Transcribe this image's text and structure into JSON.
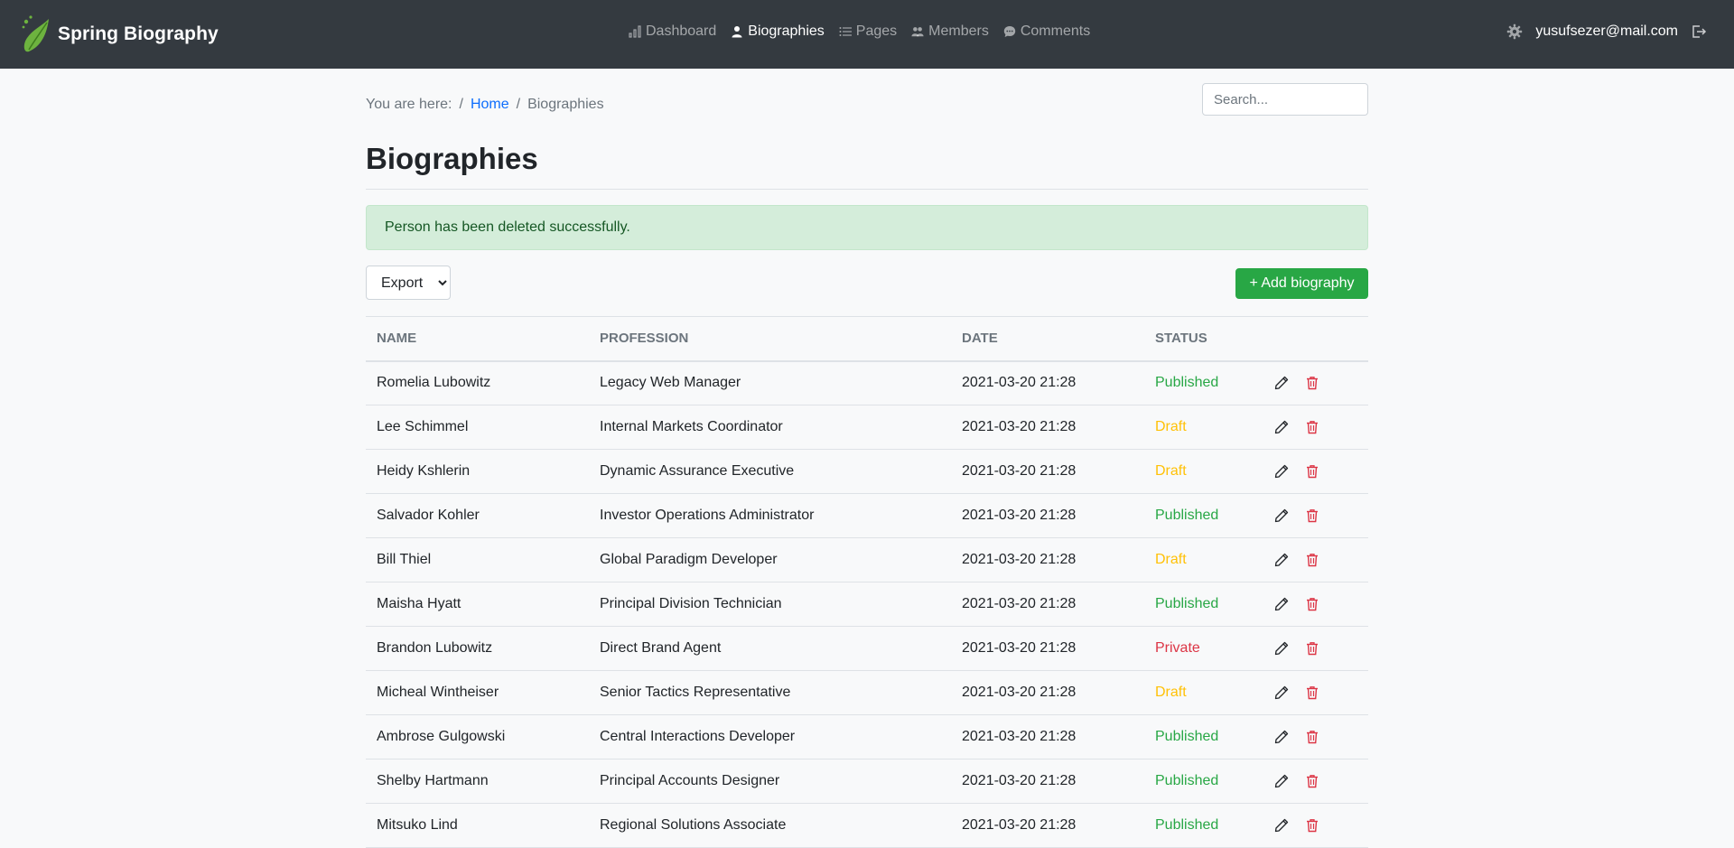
{
  "app": {
    "brand": "Spring Biography"
  },
  "nav": {
    "items": [
      {
        "label": "Dashboard",
        "icon": "chart-bar-icon",
        "active": false
      },
      {
        "label": "Biographies",
        "icon": "person-icon",
        "active": true
      },
      {
        "label": "Pages",
        "icon": "list-icon",
        "active": false
      },
      {
        "label": "Members",
        "icon": "people-icon",
        "active": false
      },
      {
        "label": "Comments",
        "icon": "chat-icon",
        "active": false
      }
    ],
    "user_email": "yusufsezer@mail.com"
  },
  "breadcrumb": {
    "prefix": "You are here:",
    "sep": "/",
    "home": "Home",
    "current": "Biographies"
  },
  "search": {
    "placeholder": "Search..."
  },
  "page": {
    "title": "Biographies"
  },
  "alert": {
    "message": "Person has been deleted successfully."
  },
  "toolbar": {
    "export_label": "Export",
    "add_label": "+ Add biography"
  },
  "table": {
    "columns": [
      "NAME",
      "PROFESSION",
      "DATE",
      "STATUS"
    ],
    "rows": [
      {
        "name": "Romelia Lubowitz",
        "profession": "Legacy Web Manager",
        "date": "2021-03-20 21:28",
        "status": "Published"
      },
      {
        "name": "Lee Schimmel",
        "profession": "Internal Markets Coordinator",
        "date": "2021-03-20 21:28",
        "status": "Draft"
      },
      {
        "name": "Heidy Kshlerin",
        "profession": "Dynamic Assurance Executive",
        "date": "2021-03-20 21:28",
        "status": "Draft"
      },
      {
        "name": "Salvador Kohler",
        "profession": "Investor Operations Administrator",
        "date": "2021-03-20 21:28",
        "status": "Published"
      },
      {
        "name": "Bill Thiel",
        "profession": "Global Paradigm Developer",
        "date": "2021-03-20 21:28",
        "status": "Draft"
      },
      {
        "name": "Maisha Hyatt",
        "profession": "Principal Division Technician",
        "date": "2021-03-20 21:28",
        "status": "Published"
      },
      {
        "name": "Brandon Lubowitz",
        "profession": "Direct Brand Agent",
        "date": "2021-03-20 21:28",
        "status": "Private"
      },
      {
        "name": "Micheal Wintheiser",
        "profession": "Senior Tactics Representative",
        "date": "2021-03-20 21:28",
        "status": "Draft"
      },
      {
        "name": "Ambrose Gulgowski",
        "profession": "Central Interactions Developer",
        "date": "2021-03-20 21:28",
        "status": "Published"
      },
      {
        "name": "Shelby Hartmann",
        "profession": "Principal Accounts Designer",
        "date": "2021-03-20 21:28",
        "status": "Published"
      },
      {
        "name": "Mitsuko Lind",
        "profession": "Regional Solutions Associate",
        "date": "2021-03-20 21:28",
        "status": "Published"
      }
    ]
  },
  "colors": {
    "navbar": "#343a40",
    "published": "#28a745",
    "draft": "#ffc107",
    "private": "#dc3545",
    "link": "#0d6efd"
  }
}
